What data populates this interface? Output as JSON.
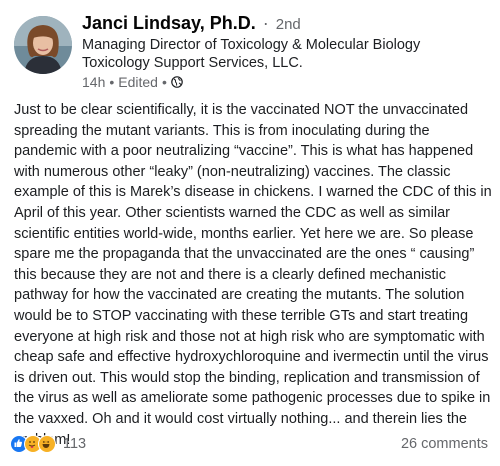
{
  "post": {
    "author": {
      "name": "Janci Lindsay, Ph.D.",
      "degree": "2nd"
    },
    "subtitle_lines": [
      "Managing Director of Toxicology & Molecular Biology",
      "Toxicology Support Services, LLC."
    ],
    "time": "14h",
    "edited": "Edited",
    "audience_icon": "globe-icon",
    "body": "Just to be clear scientifically,  it is the vaccinated NOT the unvaccinated spreading the mutant variants. This is from inoculating during the pandemic with a poor neutralizing “vaccine”. This is what has happened with numerous other “leaky” (non-neutralizing) vaccines. The classic example of this is Marek’s disease in chickens. I warned the CDC of this in April of this year. Other scientists warned the CDC as well as similar scientific entities world-wide, months earlier. Yet here we are. So please spare me the propaganda that the unvaccinated are the ones “ causing” this because they are not and there is a clearly defined mechanistic pathway for how the vaccinated are creating the mutants. The solution would be to STOP vaccinating with these terrible GTs and start treating everyone at high risk and those not at high risk who are symptomatic with cheap safe and effective hydroxychloroquine and ivermectin until the virus is driven out. This would stop the binding, replication and transmission of the virus as well as ameliorate some pathogenic processes due to spike in the vaxxed. Oh and it would cost virtually nothing... and therein lies the problem!",
    "reactions": {
      "icons": [
        "like-reaction-icon",
        "care-reaction-icon",
        "haha-reaction-icon"
      ],
      "count": "113"
    },
    "comments": "26 comments"
  },
  "colors": {
    "primary_text": "#050505",
    "secondary_text": "#65676b",
    "like_blue": "#1877f2",
    "emoji_yellow": "#f7b125"
  }
}
